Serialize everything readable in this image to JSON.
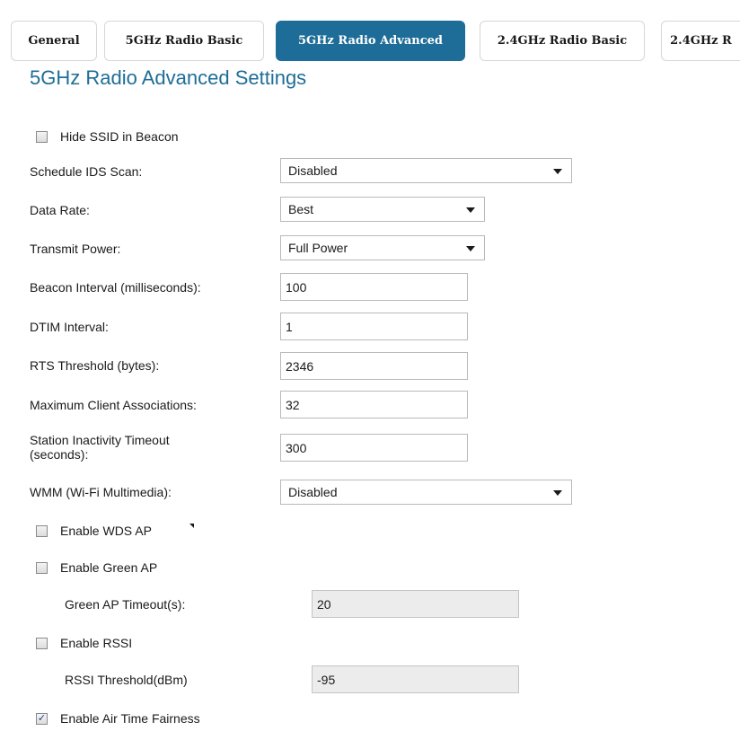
{
  "tabs": [
    {
      "label": "General",
      "active": false
    },
    {
      "label": "5GHz Radio Basic",
      "active": false
    },
    {
      "label": "5GHz Radio Advanced",
      "active": true
    },
    {
      "label": "2.4GHz Radio Basic",
      "active": false
    },
    {
      "label": "2.4GHz R",
      "active": false
    }
  ],
  "page_title": "5GHz Radio Advanced Settings",
  "hide_ssid": {
    "label": "Hide SSID in Beacon",
    "checked": false
  },
  "schedule_ids": {
    "label": "Schedule IDS Scan:",
    "value": "Disabled"
  },
  "data_rate": {
    "label": "Data Rate:",
    "value": "Best"
  },
  "transmit_power": {
    "label": "Transmit Power:",
    "value": "Full Power"
  },
  "beacon_interval": {
    "label": "Beacon Interval (milliseconds):",
    "value": "100"
  },
  "dtim_interval": {
    "label": "DTIM Interval:",
    "value": "1"
  },
  "rts_threshold": {
    "label": "RTS Threshold (bytes):",
    "value": "2346"
  },
  "max_clients": {
    "label": "Maximum Client Associations:",
    "value": "32"
  },
  "station_timeout": {
    "label_line1": "Station Inactivity Timeout",
    "label_line2": "(seconds):",
    "value": "300"
  },
  "wmm": {
    "label": "WMM (Wi-Fi Multimedia):",
    "value": "Disabled"
  },
  "wds_ap": {
    "label": "Enable WDS AP",
    "checked": false
  },
  "green_ap": {
    "label": "Enable Green AP",
    "checked": false
  },
  "green_ap_timeout": {
    "label": "Green AP Timeout(s):",
    "value": "20"
  },
  "rssi": {
    "label": "Enable RSSI",
    "checked": false
  },
  "rssi_threshold": {
    "label": "RSSI Threshold(dBm)",
    "value": "-95"
  },
  "air_time_fairness": {
    "label": "Enable Air Time Fairness",
    "checked": true,
    "check_glyph": "✓"
  },
  "colors": {
    "accent": "#1e6d98",
    "text": "#1a1a1a",
    "disabled_bg": "#ececec"
  }
}
